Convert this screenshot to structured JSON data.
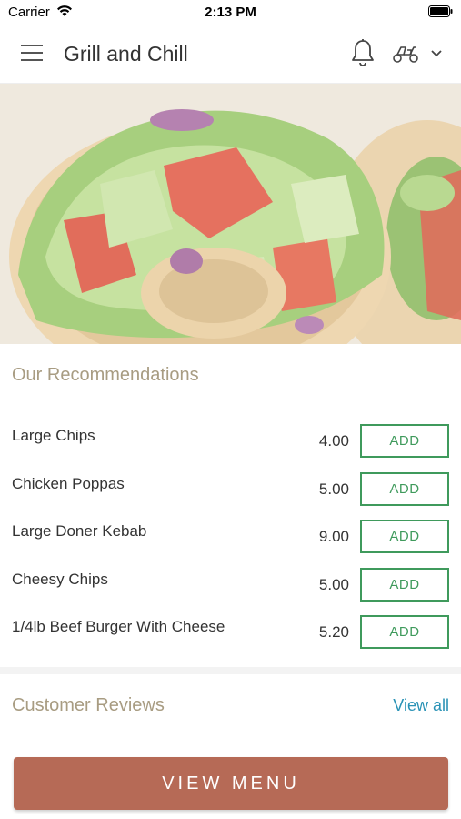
{
  "status_bar": {
    "carrier": "Carrier",
    "time": "2:13 PM"
  },
  "header": {
    "title": "Grill and Chill"
  },
  "recommendations": {
    "title": "Our Recommendations",
    "add_label": "ADD",
    "items": [
      {
        "name": "Large Chips",
        "price": "4.00"
      },
      {
        "name": "Chicken Poppas",
        "price": "5.00"
      },
      {
        "name": "Large Doner Kebab",
        "price": "9.00"
      },
      {
        "name": "Cheesy Chips",
        "price": "5.00"
      },
      {
        "name": "1/4lb Beef Burger With Cheese",
        "price": "5.20"
      }
    ]
  },
  "reviews": {
    "title": "Customer Reviews",
    "view_all": "View all"
  },
  "footer": {
    "view_menu": "VIEW MENU"
  },
  "colors": {
    "accent_green": "#3f9a5c",
    "view_menu_bg": "#b66a56",
    "section_title": "#a89c82",
    "link": "#2b93b6"
  },
  "icons": [
    "wifi-icon",
    "battery-icon",
    "menu-icon",
    "bell-icon",
    "delivery-scooter-icon",
    "chevron-down-icon"
  ]
}
